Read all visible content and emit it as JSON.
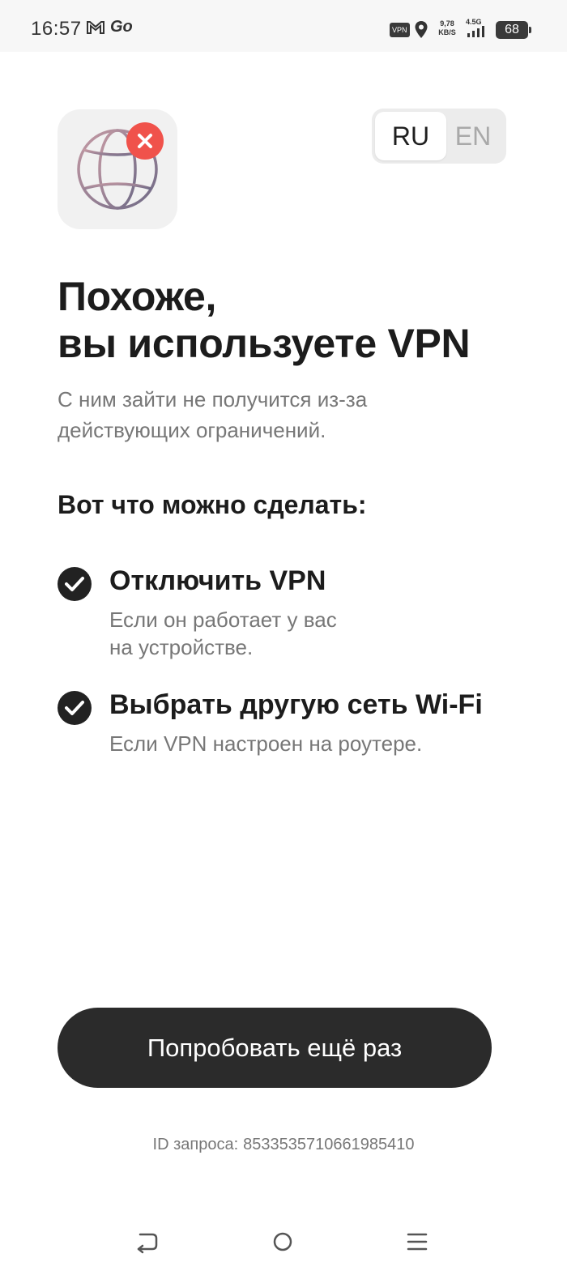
{
  "status_bar": {
    "time": "16:57",
    "vpn_badge": "VPN",
    "speed_value": "9,78",
    "speed_unit": "KB/S",
    "network": "4.5G",
    "battery": "68"
  },
  "lang_toggle": {
    "options": [
      {
        "label": "RU",
        "selected": true
      },
      {
        "label": "EN",
        "selected": false
      }
    ]
  },
  "main": {
    "title_line1": "Похоже,",
    "title_line2": "вы используете VPN",
    "subtitle_line1": "С ним зайти не получится из-за",
    "subtitle_line2": "действующих ограничений.",
    "section_heading": "Вот что можно сделать:",
    "options": [
      {
        "title": "Отключить VPN",
        "desc_line1": "Если он работает у вас",
        "desc_line2": "на устройстве."
      },
      {
        "title": "Выбрать другую сеть Wi-Fi",
        "desc_line1": "Если VPN настроен на роутере.",
        "desc_line2": ""
      }
    ]
  },
  "retry_button": {
    "label": "Попробовать ещё раз"
  },
  "request": {
    "label": "ID запроса:",
    "value": "8533535710661985410"
  },
  "colors": {
    "error_badge": "#f0524b",
    "button_bg": "#2b2b2b",
    "globe_gradient_start": "#c59aa4",
    "globe_gradient_end": "#6f6a86"
  },
  "icons": {
    "app_icon": "globe-icon",
    "error_badge": "close-icon",
    "option_check": "check-icon",
    "nav_back": "back-icon",
    "nav_home": "home-icon",
    "nav_menu": "menu-icon"
  }
}
